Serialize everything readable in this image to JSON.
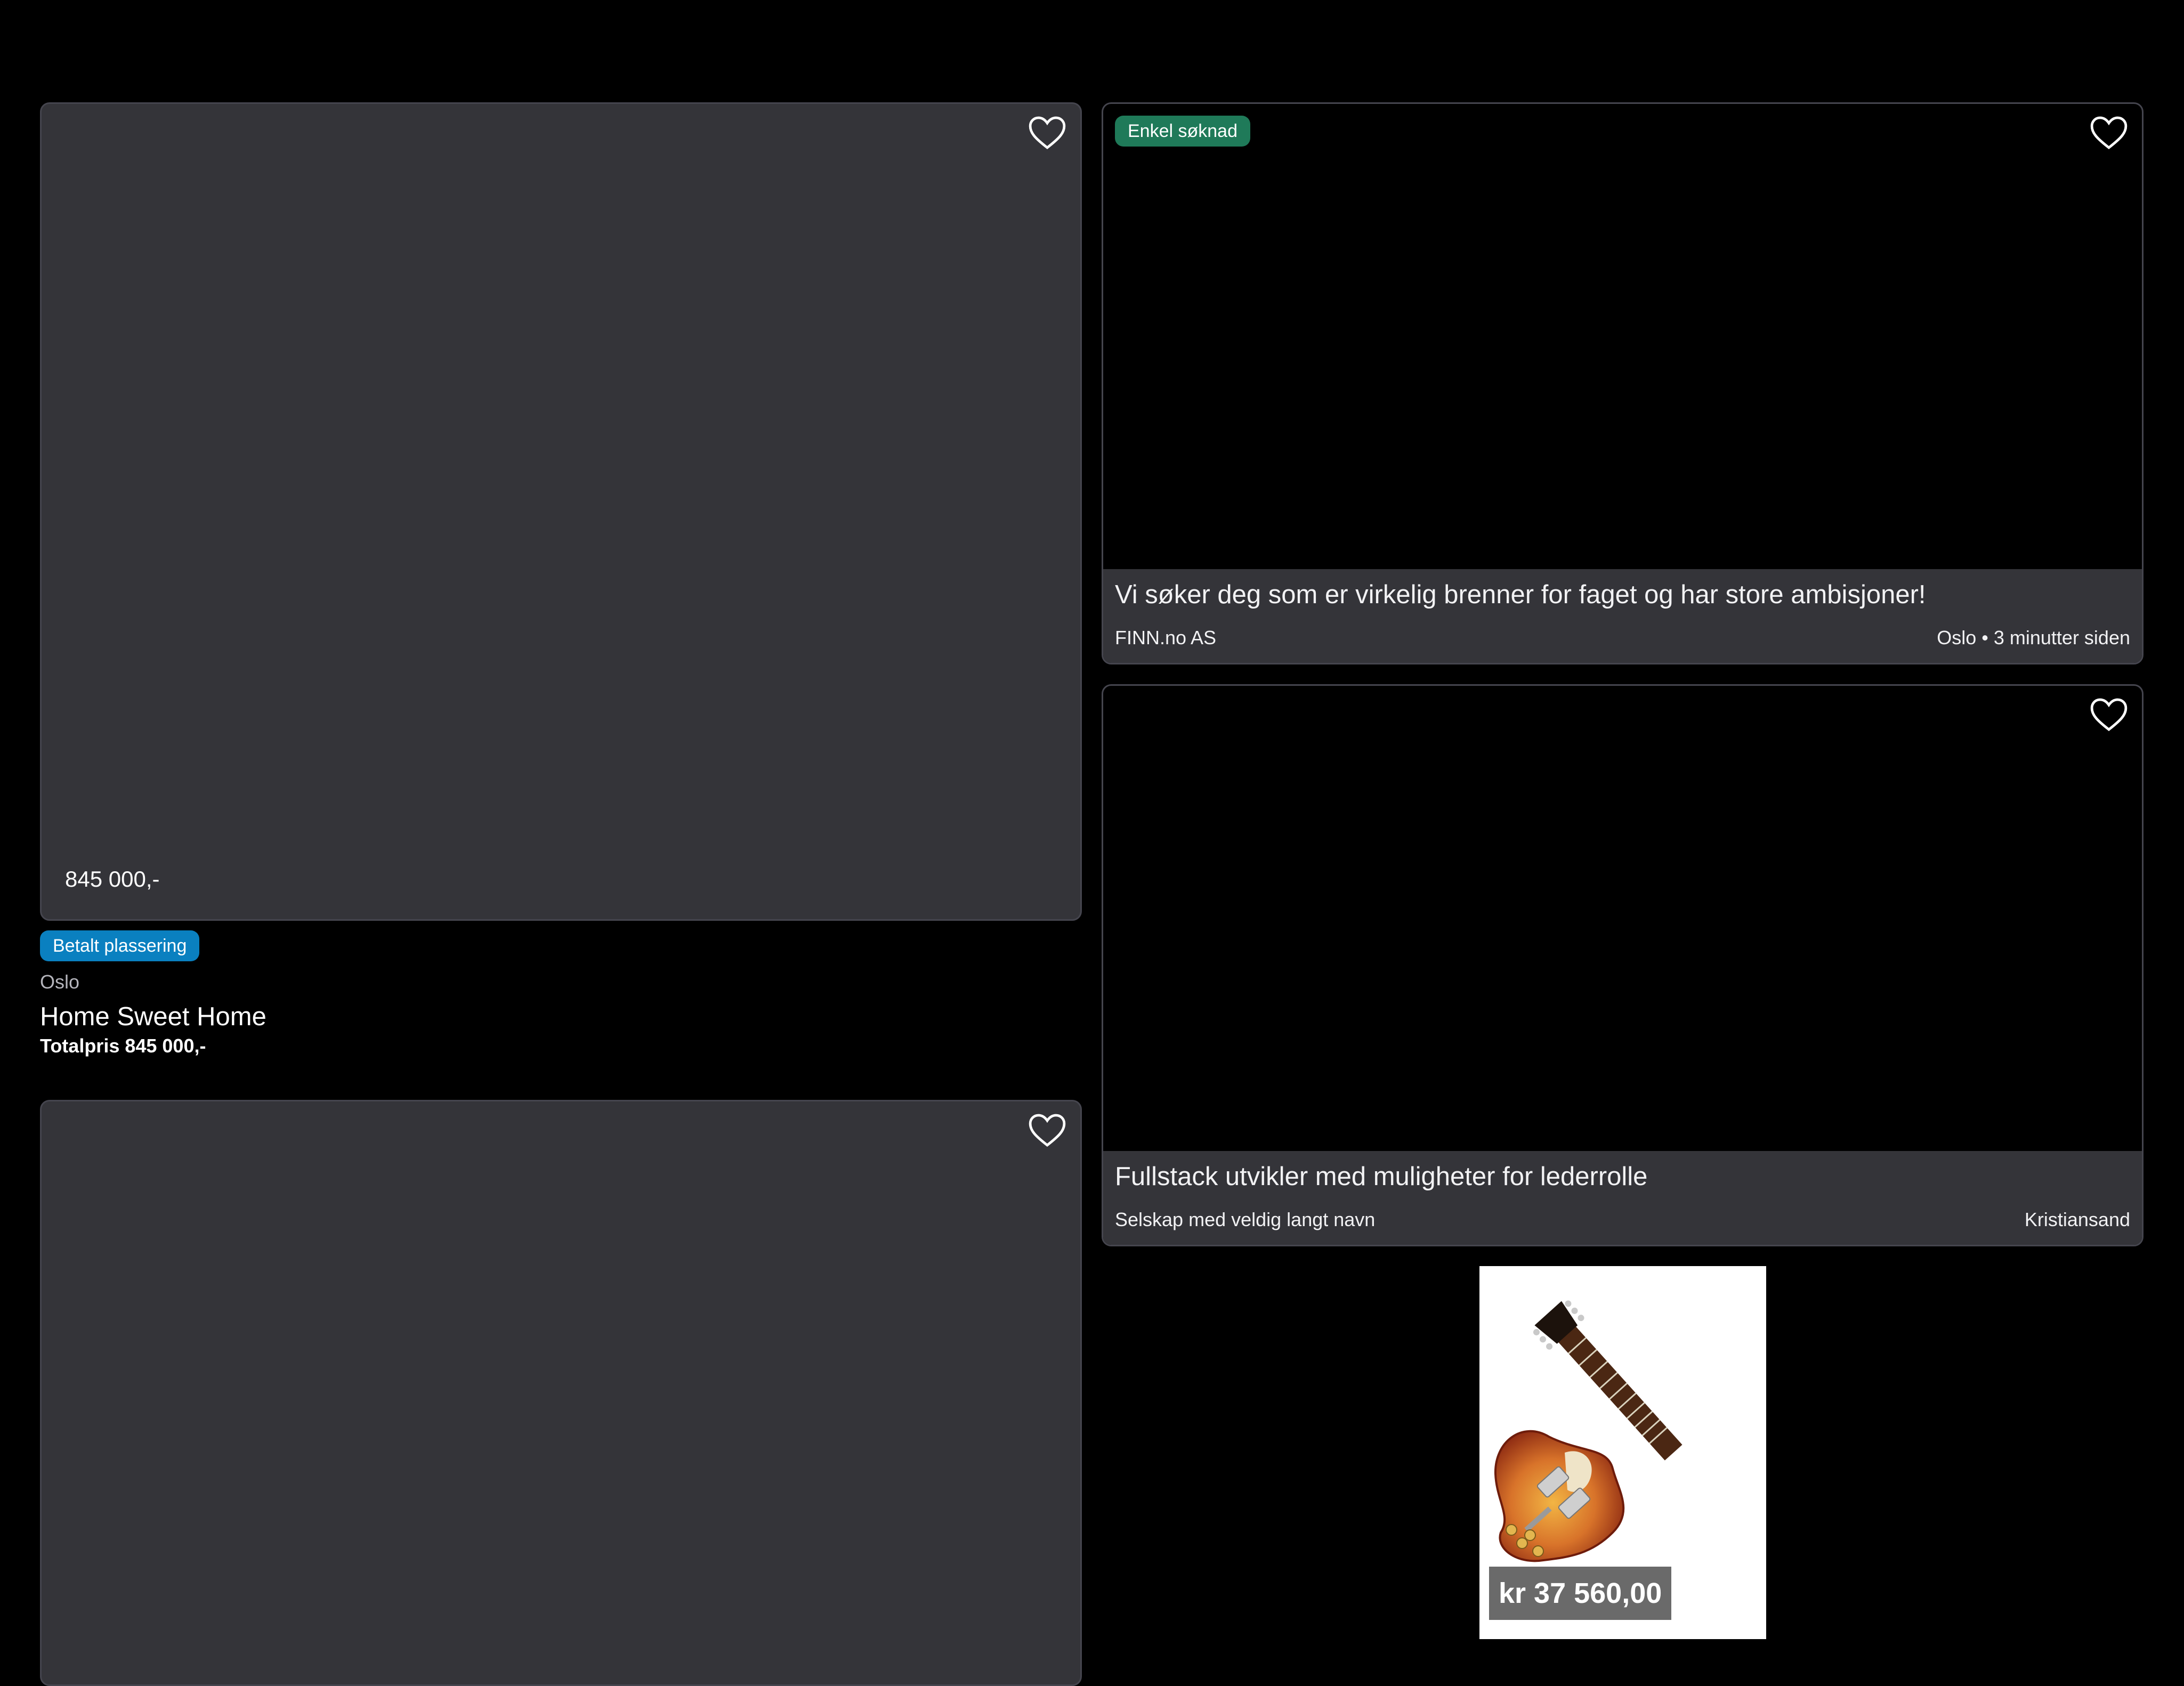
{
  "listings": {
    "realestate": {
      "image_price": "845 000,-",
      "badge": "Betalt plassering",
      "location": "Oslo",
      "title": "Home Sweet Home",
      "total_price": "Totalpris 845 000,-"
    },
    "job1": {
      "badge": "Enkel søknad",
      "title": "Vi søker deg som er virkelig brenner for faget og har store ambisjoner!",
      "company": "FINN.no AS",
      "meta": "Oslo • 3 minutter siden"
    },
    "job2": {
      "title": "Fullstack utvikler med muligheter for lederrolle",
      "company": "Selskap med veldig langt navn",
      "location": "Kristiansand"
    },
    "product_ad": {
      "price": "kr 37 560,00"
    }
  },
  "icons": {
    "favorite": "heart-outline-icon"
  },
  "colors": {
    "page_background": "#000000",
    "card_surface": "#343439",
    "paid_badge": "#0a80c0",
    "easy_apply_badge": "#1f7a59"
  }
}
